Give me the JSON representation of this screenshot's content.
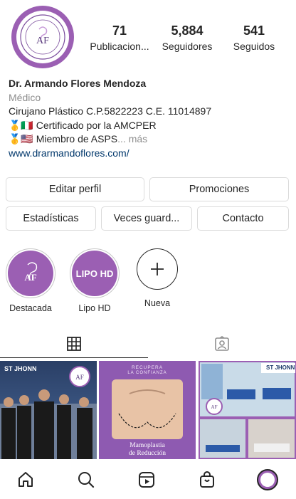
{
  "profile": {
    "stats": [
      {
        "value": "71",
        "label": "Publicacion..."
      },
      {
        "value": "5,884",
        "label": "Seguidores"
      },
      {
        "value": "541",
        "label": "Seguidos"
      }
    ],
    "name": "Dr. Armando Flores Mendoza",
    "category": "Médico",
    "bio_line1": "Cirujano Plástico C.P.5822223 C.E. 11014897",
    "bio_line2": "🥇🇮🇹 Certificado por la AMCPER",
    "bio_line3_prefix": "🥇🇺🇸 Miembro de ASPS",
    "bio_more": "... más",
    "website": "www.drarmandoflores.com/"
  },
  "buttons": {
    "edit_profile": "Editar perfil",
    "promotions": "Promociones",
    "stats": "Estadísticas",
    "saved_views": "Veces guard...",
    "contact": "Contacto"
  },
  "highlights": [
    {
      "label": "Destacada",
      "cover_text": ""
    },
    {
      "label": "Lipo HD",
      "cover_text": "LIPO HD"
    },
    {
      "label": "Nueva",
      "cover_text": ""
    }
  ],
  "posts": [
    {
      "brand": "ST JHONN"
    },
    {
      "top_text": "RECUPERA",
      "sub_text": "LA CONFIANZA",
      "caption_line1": "Mamoplastia",
      "caption_line2": "de Reducción"
    },
    {
      "brand": "ST JHONN"
    }
  ],
  "colors": {
    "brand_purple": "#9b5fb3",
    "link": "#00376b",
    "muted": "#8e8e8e",
    "border": "#dbdbdb"
  }
}
